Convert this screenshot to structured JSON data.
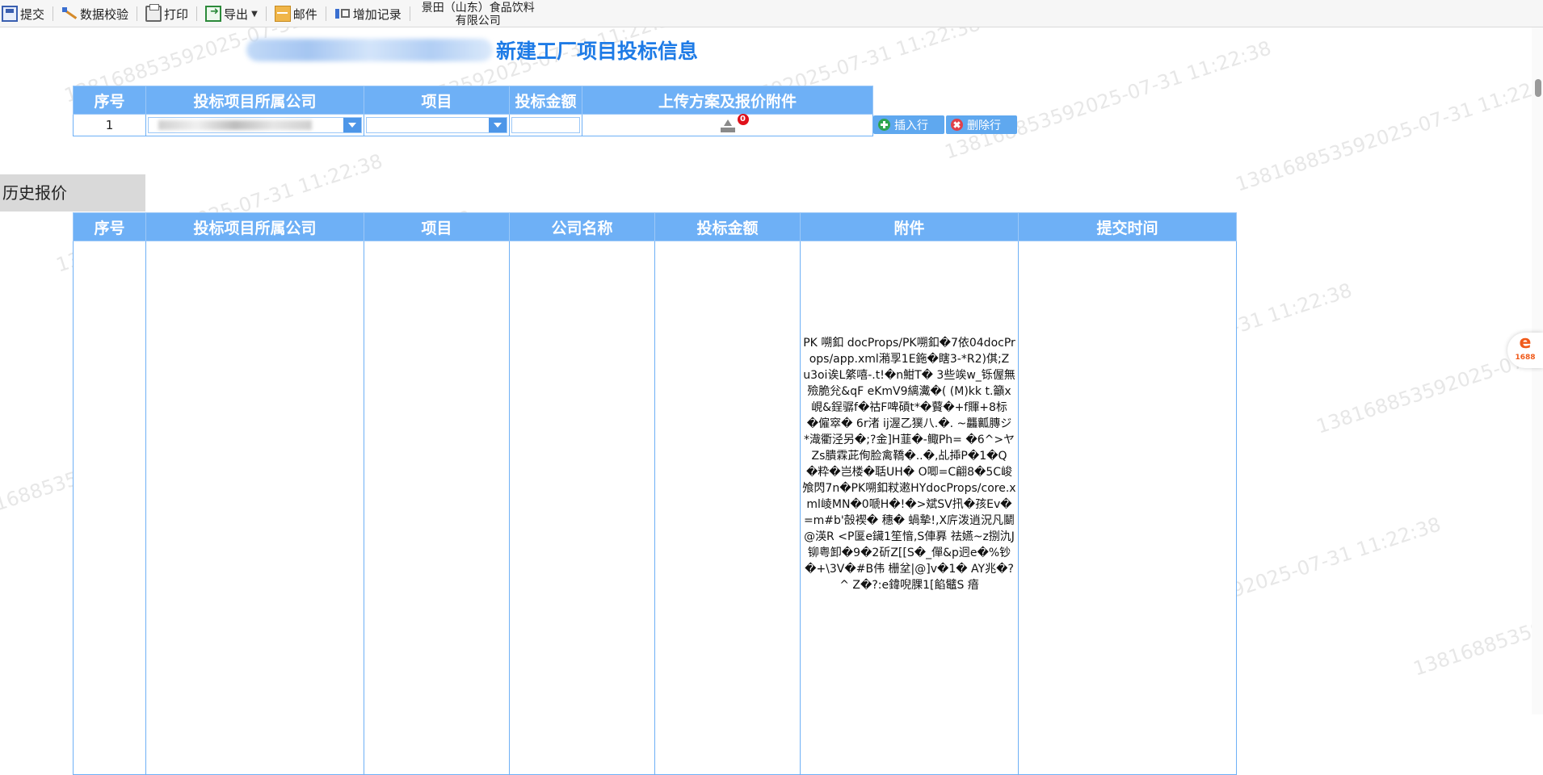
{
  "toolbar": {
    "submit": "提交",
    "validate": "数据校验",
    "print": "打印",
    "export": "导出",
    "mail": "邮件",
    "add_record": "增加记录",
    "company_line1": "景田（山东）食品饮料",
    "company_line2": "有限公司"
  },
  "page_title": "新建工厂项目投标信息",
  "entry_table": {
    "headers": [
      "序号",
      "投标项目所属公司",
      "项目",
      "投标金额",
      "上传方案及报价附件"
    ],
    "row": {
      "index": "1",
      "attachment_count": "0"
    }
  },
  "buttons": {
    "insert_row": "插入行",
    "delete_row": "删除行"
  },
  "history": {
    "label": "历史报价",
    "headers": [
      "序号",
      "投标项目所属公司",
      "项目",
      "公司名称",
      "投标金额",
      "附件",
      "提交时间"
    ],
    "attachment_text": "PK\u0003\u0004 嗍釦 docProps/PK\u0003\u0004\u0003\u0004嗍釦�7依0\u00034\u0003\u0003docProps/app.xml潲孠\u00031\u0003E鉇�\u0003瞎3-*R2)倛;\u0003Zu\u00033oi诶L\u0003綮嘻-.t!�\u0003n魽T� 3\u0003些竢w_铄偓\u0003無殮脆兊&\u0003qF \u0003eKmV9縭瀻�( (M)kk \u0003\u0003t.籲x峴\u0003\u0003\u0003\u0003\u0003\u0003&\u0003鋥骣f�\u0003祜F啤碽t*�\u0003藖�+f賱+8标�\u0003僱窣� 6\u0003\u0003r渚 ij渥\u0003乙獛八.�.\u0003 ~龘瓤膞ジ*\u0003渽衢泾另�;?\u0003金]H韮�-鲰Ph= �6^>ヤZ\u0003\u0003\u0003s膭\u0003霖茈侚脸\u0003禽\u0003鞽�..�,\u0003乩揷P�\u00031�\u0003Q�\u0003粋�\u0003岂楼�\u0003聒UH� O唧=C翩8�5\u0003C峻飧閃7\u0003n�\u0003PK\u0003\u0003\u0003\u0003嗍釦粀遫H\u0003Y\u0003\u0003docProps/core.xml崚MN�0\u0003嗁H�!�>斌S\u0003V扟�孩\u0003\u0003Ev�=m#b'嗀褉� 穗� 蝸摰!\u0003,X庍泼逍況凡鬭@渶R\u0003 \u0003\u0003<P\u0003\u0003匽e鑶1笙愔,S俥奡 祛嬿~z捌氿J铆粤卸�9�2斫\u0003Z[[S�_僤&p\u0003迥e�%钞�+\\3\u0003V�#B伟\u0003\u0003\u0003\u0003\u0003 栅\u0003\u0003坌\u0003\u0003|@\u0003\u0003]v�1� AY兆�?^ Z�?\u0003:e鍏唲腂\u0003\u00031[餡\u0003鼊S 瘖"
  },
  "watermark": "138168853592025-07-31 11:22:38",
  "colors": {
    "header_bg": "#6eb0f6",
    "title": "#1e7be6",
    "button_bg": "#5fa8ef"
  },
  "side_widget": {
    "label": "1688",
    "glyph": "e"
  }
}
